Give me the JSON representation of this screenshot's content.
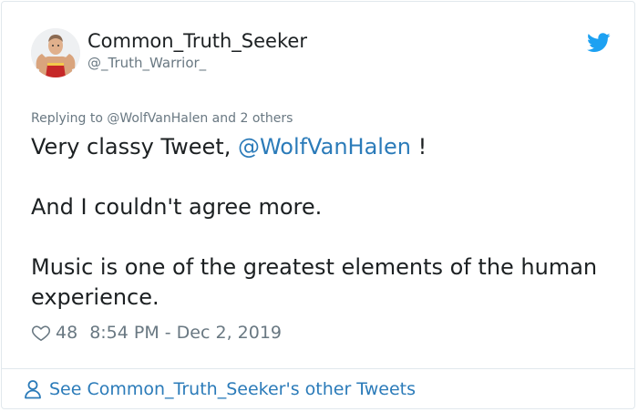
{
  "author": {
    "display_name": "Common_Truth_Seeker",
    "handle": "@_Truth_Warrior_",
    "avatar_icon": "wrestler-avatar"
  },
  "reply_context": {
    "prefix": "Replying to ",
    "mention": "@WolfVanHalen",
    "suffix": " and 2 others"
  },
  "tweet": {
    "line1_before": "Very classy Tweet, ",
    "line1_mention": "@WolfVanHalen",
    "line1_after": " !",
    "line2": "And I couldn't agree more.",
    "line3": "Music is one of the greatest elements of the human experience."
  },
  "stats": {
    "likes": "48",
    "timestamp": "8:54 PM - Dec 2, 2019"
  },
  "footer": {
    "link_text": "See Common_Truth_Seeker's other Tweets"
  },
  "colors": {
    "twitter_blue": "#1da1f2",
    "link_blue": "#2b7bb9",
    "muted_gray": "#697882",
    "text": "#1c2022"
  }
}
